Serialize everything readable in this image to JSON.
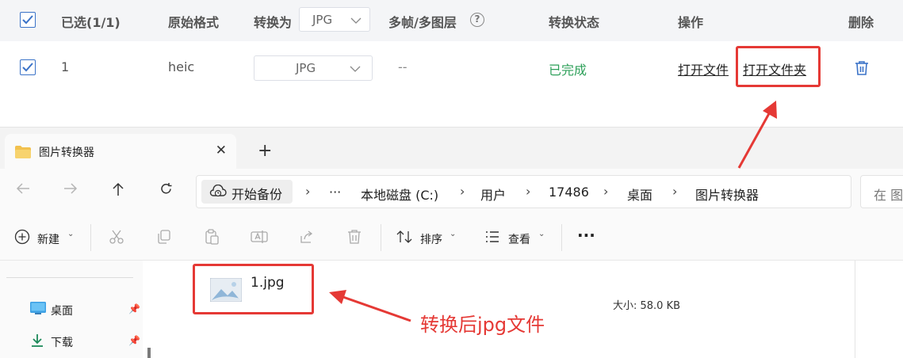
{
  "converter": {
    "header": {
      "selected": "已选(1/1)",
      "original_format": "原始格式",
      "convert_to": "转换为",
      "convert_to_value": "JPG",
      "multi_frame": "多帧/多图层",
      "help_icon": "?",
      "status": "转换状态",
      "actions": "操作",
      "delete": "删除"
    },
    "row": {
      "index": "1",
      "format": "heic",
      "target": "JPG",
      "frames": "--",
      "status": "已完成",
      "open_file": "打开文件",
      "open_folder": "打开文件夹"
    },
    "colors": {
      "status_done": "#2ea05a",
      "accent": "#3b73c8",
      "highlight": "#e53935"
    }
  },
  "explorer": {
    "tab_title": "图片转换器",
    "tab_close": "✕",
    "new_tab": "+",
    "backup": "开始备份",
    "ellipsis": "···",
    "breadcrumbs": [
      "本地磁盘 (C:)",
      "用户",
      "17486",
      "桌面",
      "图片转换器"
    ],
    "search_placeholder": "在 图",
    "toolbar": {
      "new": "新建",
      "sort": "排序",
      "view": "查看",
      "more": "···"
    },
    "sidebar": [
      {
        "label": "桌面",
        "icon": "desktop-icon"
      },
      {
        "label": "下载",
        "icon": "download-icon"
      }
    ],
    "file": {
      "name": "1.jpg",
      "size": "大小: 58.0 KB"
    }
  },
  "annotation": "转换后jpg文件"
}
